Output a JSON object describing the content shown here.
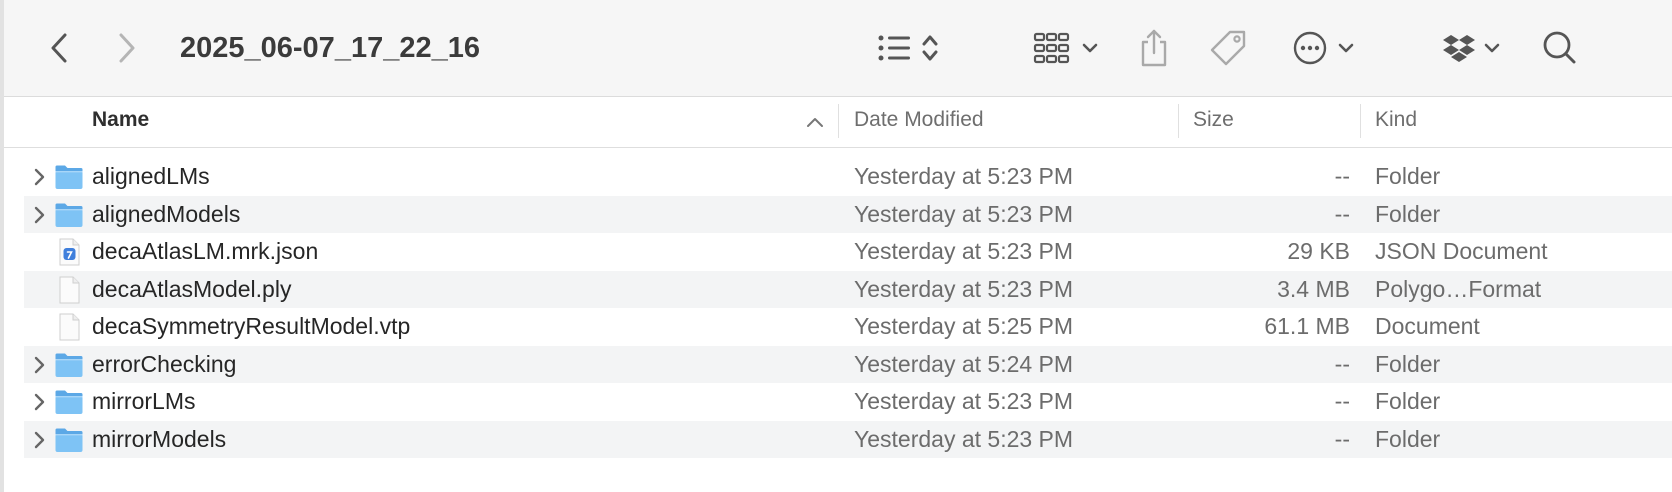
{
  "window": {
    "title": "2025_06-07_17_22_16"
  },
  "toolbar": {
    "icons": [
      "chevron-left-icon",
      "chevron-right-icon",
      "list-view-icon",
      "grid-view-icon",
      "share-icon",
      "tag-icon",
      "more-icon",
      "dropbox-icon",
      "search-icon"
    ]
  },
  "columns": {
    "name": "Name",
    "date": "Date Modified",
    "size": "Size",
    "kind": "Kind",
    "sort_column": "Name",
    "sort_direction": "ascending"
  },
  "files": [
    {
      "name": "alignedLMs",
      "date": "Yesterday at 5:23 PM",
      "size": "--",
      "kind": "Folder",
      "icon": "folder-icon",
      "expandable": true
    },
    {
      "name": "alignedModels",
      "date": "Yesterday at 5:23 PM",
      "size": "--",
      "kind": "Folder",
      "icon": "folder-icon",
      "expandable": true
    },
    {
      "name": "decaAtlasLM.mrk.json",
      "date": "Yesterday at 5:23 PM",
      "size": "29 KB",
      "kind": "JSON Document",
      "icon": "json-file-icon",
      "expandable": false
    },
    {
      "name": "decaAtlasModel.ply",
      "date": "Yesterday at 5:23 PM",
      "size": "3.4 MB",
      "kind": "Polygo…Format",
      "icon": "document-icon",
      "expandable": false
    },
    {
      "name": "decaSymmetryResultModel.vtp",
      "date": "Yesterday at 5:25 PM",
      "size": "61.1 MB",
      "kind": "Document",
      "icon": "document-icon",
      "expandable": false
    },
    {
      "name": "errorChecking",
      "date": "Yesterday at 5:24 PM",
      "size": "--",
      "kind": "Folder",
      "icon": "folder-icon",
      "expandable": true
    },
    {
      "name": "mirrorLMs",
      "date": "Yesterday at 5:23 PM",
      "size": "--",
      "kind": "Folder",
      "icon": "folder-icon",
      "expandable": true
    },
    {
      "name": "mirrorModels",
      "date": "Yesterday at 5:23 PM",
      "size": "--",
      "kind": "Folder",
      "icon": "folder-icon",
      "expandable": true
    }
  ],
  "colors": {
    "folder": "#7ec3f5",
    "folder_tab": "#5ca8e6",
    "json_badge": "#3f7fdc",
    "row_alt": "#f3f4f5",
    "toolbar_bg": "#f6f6f6"
  }
}
